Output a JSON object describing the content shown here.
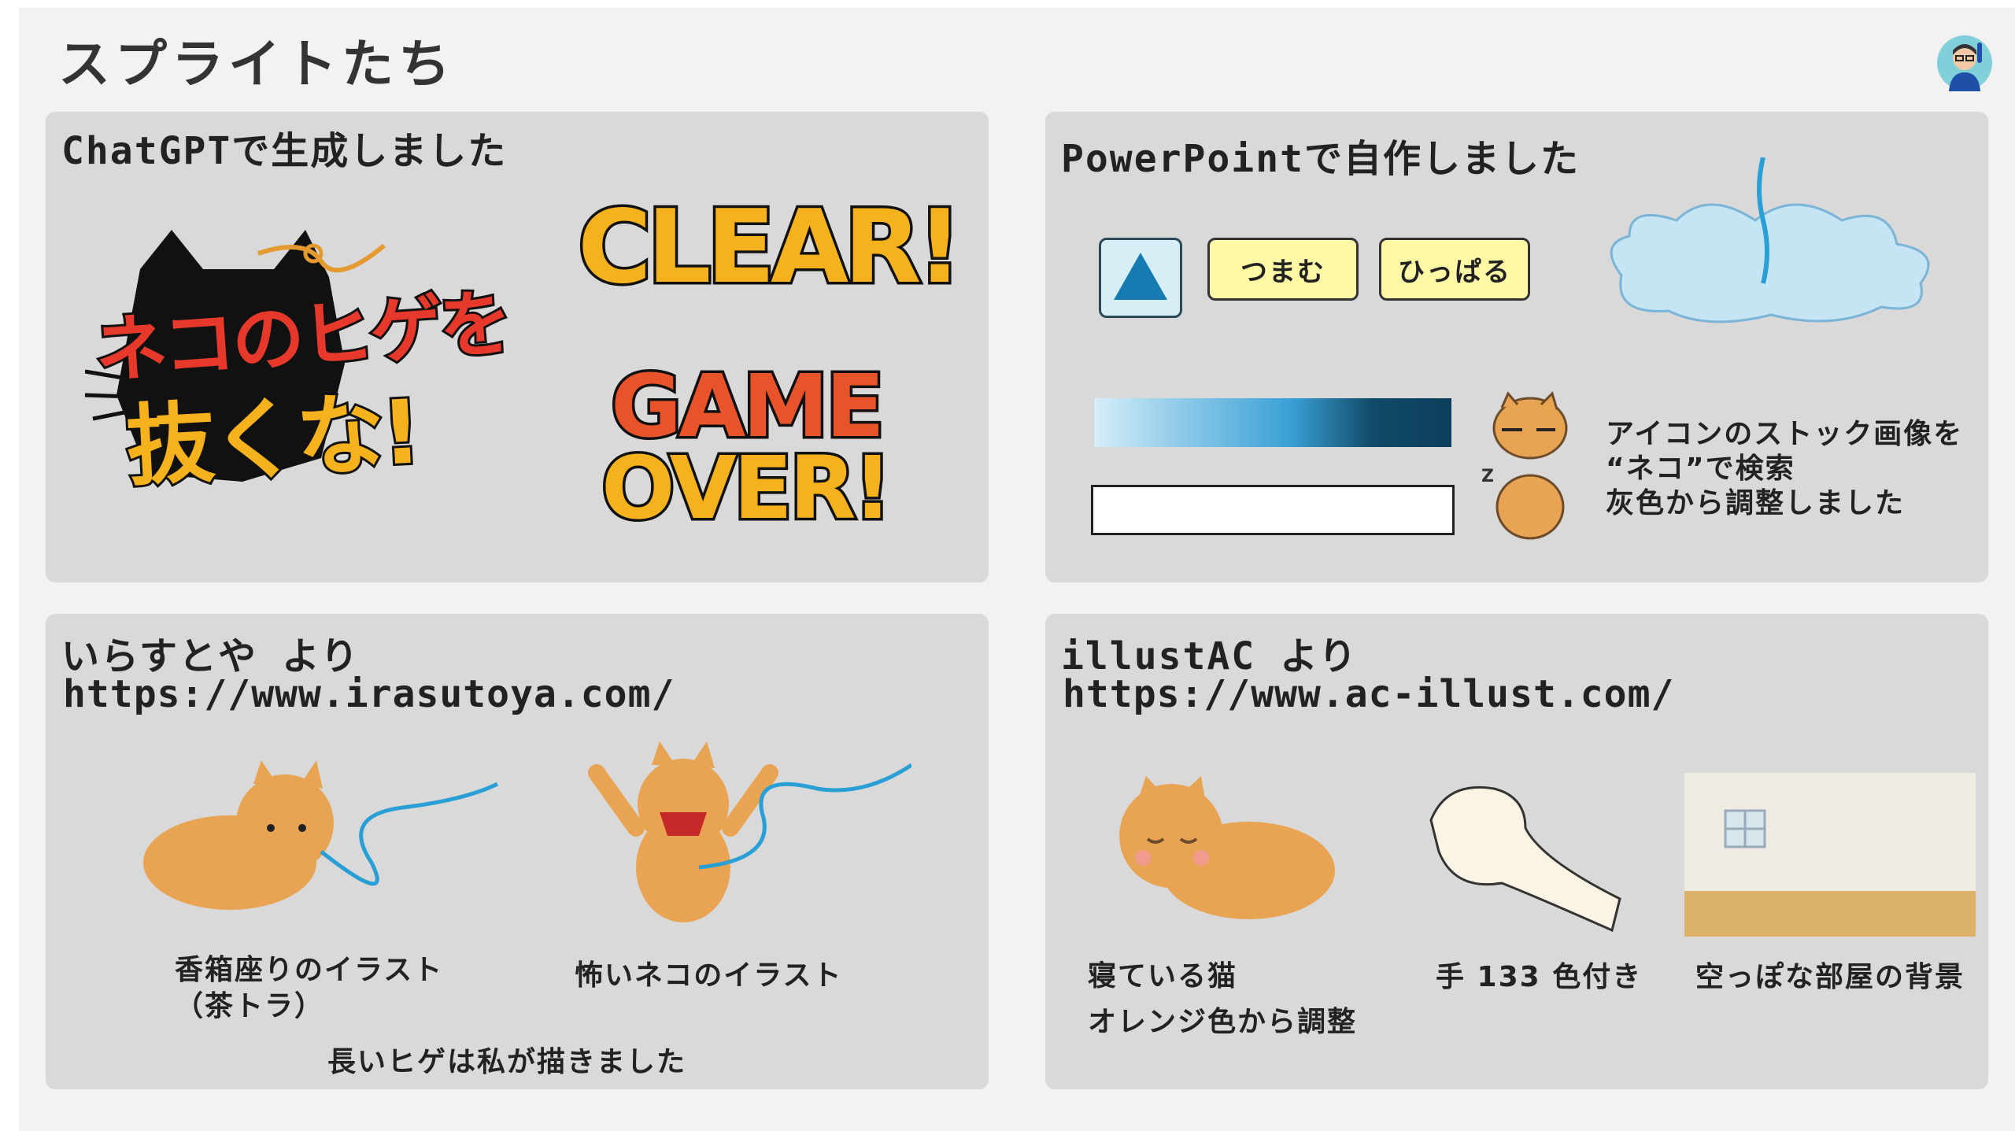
{
  "page": {
    "title": "スプライトたち"
  },
  "panels": {
    "chatgpt": {
      "title": "ChatGPTで生成しました",
      "logo_line1": "ネコのヒゲを",
      "logo_line2": "抜くな!",
      "clear_text": "CLEAR!",
      "gameover_line1": "GAME",
      "gameover_line2": "OVER!"
    },
    "powerpoint": {
      "title": "PowerPointで自作しました",
      "btn_pinch": "つまむ",
      "btn_pull": "ひっぱる",
      "gauge_fill_fraction": 1.0,
      "note_lines": [
        "アイコンのストック画像を",
        "“ネコ”で検索",
        "灰色から調整しました"
      ]
    },
    "irasutoya": {
      "title": "いらすとや より",
      "url": "https://www.irasutoya.com/",
      "caption1": "香箱座りのイラスト\n（茶トラ）",
      "caption2": "怖いネコのイラスト",
      "note": "長いヒゲは私が描きました"
    },
    "illustac": {
      "title": "illustAC より",
      "url": "https://www.ac-illust.com/",
      "caption1": "寝ている猫\nオレンジ色から調整",
      "caption2": "手 133 色付き",
      "caption3": "空っぽな部屋の背景"
    }
  },
  "colors": {
    "panel_bg": "#d9d9d9",
    "slide_bg": "#f2f2f2",
    "button_fill": "#fff9a6",
    "cat_orange": "#e8a453",
    "whisker_blue": "#2a9fd6"
  },
  "icons": [
    "avatar-icon",
    "play-triangle-icon",
    "cloud-icon",
    "cat-icon",
    "hand-icon",
    "room-icon"
  ]
}
